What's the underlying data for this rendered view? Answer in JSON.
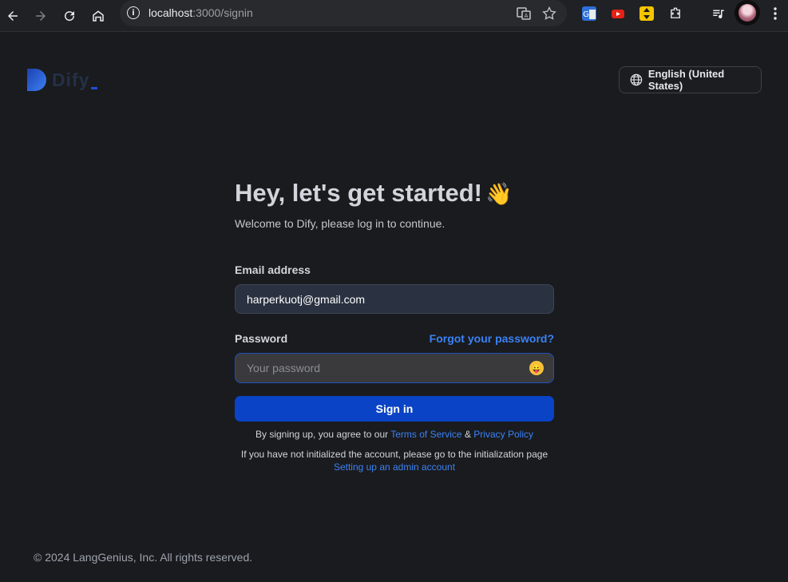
{
  "browser": {
    "url_host": "localhost",
    "url_path": ":3000/signin"
  },
  "header": {
    "logo_text": "Dify",
    "language_label": "English (United States)"
  },
  "signin": {
    "title": "Hey, let's get started!",
    "wave_emoji": "👋",
    "subtitle": "Welcome to Dify, please log in to continue.",
    "email_label": "Email address",
    "email_value": "harperkuotj@gmail.com",
    "password_label": "Password",
    "forgot_link": "Forgot your password?",
    "password_placeholder": "Your password",
    "password_toggle_emoji": "😛",
    "signin_button": "Sign in",
    "terms_prefix": "By signing up, you agree to our",
    "terms_link": "Terms of Service",
    "terms_and": "&",
    "privacy_link": "Privacy Policy",
    "init_prefix": "If you have not initialized the account, please go to the initialization page",
    "init_link": "Setting up an admin account"
  },
  "footer": {
    "copyright": "© 2024 LangGenius, Inc. All rights reserved."
  },
  "colors": {
    "background": "#1a1b1e",
    "primary_button": "#0b43c6",
    "link": "#3b82f6"
  }
}
